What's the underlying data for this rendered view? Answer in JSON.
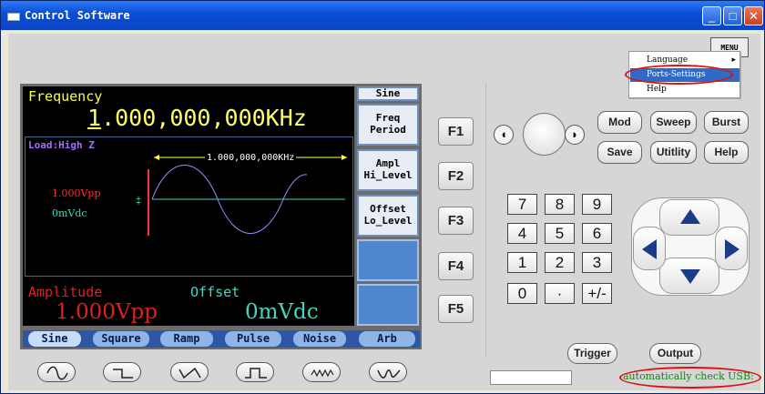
{
  "window": {
    "title": "Control Software",
    "minimize": "_",
    "maximize": "□",
    "close": "✕"
  },
  "menu": {
    "button": "MENU",
    "items": [
      "Language",
      "Ports-Settings",
      "Help"
    ],
    "selected": "Ports-Settings",
    "submenu_arrow": "▸"
  },
  "display": {
    "frequency_label": "Frequency",
    "frequency_digit": "1",
    "frequency_rest": ".000,000,000KHz",
    "load": "Load:High Z",
    "waveform_freq": "1.000,000,000KHz",
    "plot_amplitude": "1.000Vpp",
    "plot_offset": "0mVdc",
    "amplitude_label": "Amplitude",
    "amplitude_value": "1.000Vpp",
    "offset_label": "Offset",
    "offset_value": "0mVdc"
  },
  "softkeys": {
    "header": "Sine",
    "freq": "Freq",
    "period": "Period",
    "ampl": "Ampl",
    "hi_level": "Hi_Level",
    "offset": "Offset",
    "lo_level": "Lo_Level"
  },
  "tabs": [
    "Sine",
    "Square",
    "Ramp",
    "Pulse",
    "Noise",
    "Arb"
  ],
  "waveform_buttons": [
    "sine-wave-icon",
    "square-wave-icon",
    "ramp-wave-icon",
    "pulse-wave-icon",
    "noise-wave-icon",
    "arb-wave-icon"
  ],
  "function_keys": [
    "F1",
    "F2",
    "F3",
    "F4",
    "F5"
  ],
  "mode_buttons": {
    "mod": "Mod",
    "sweep": "Sweep",
    "burst": "Burst",
    "save": "Save",
    "utility": "Utitlity",
    "help": "Help"
  },
  "keypad": [
    "7",
    "8",
    "9",
    "4",
    "5",
    "6",
    "1",
    "2",
    "3",
    "0",
    "·",
    "+/-"
  ],
  "knob": {
    "left": "◖",
    "right": "◗"
  },
  "trigger": "Trigger",
  "output": "Output",
  "status": "automatically check USB:",
  "colors": {
    "selected_menu": "#316ac5",
    "highlight_ring": "#e01010",
    "status_text": "#118811"
  }
}
